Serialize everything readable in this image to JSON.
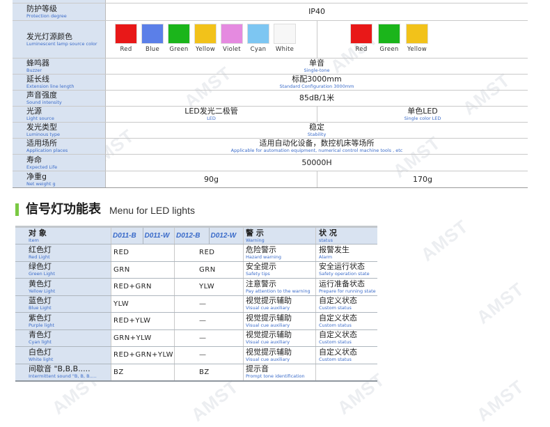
{
  "watermark": "AMST",
  "spec": {
    "top_partial": "",
    "protection": {
      "label_zh": "防护等级",
      "label_en": "Protection degree",
      "value": "IP40"
    },
    "lamp_color": {
      "label_zh": "发光灯源颜色",
      "label_en": "Luminescent lamp source color",
      "left": [
        {
          "name": "Red",
          "color": "#e81818"
        },
        {
          "name": "Blue",
          "color": "#5b7fe8"
        },
        {
          "name": "Green",
          "color": "#1bb51b"
        },
        {
          "name": "Yellow",
          "color": "#f2c21a"
        },
        {
          "name": "Violet",
          "color": "#e58ae0"
        },
        {
          "name": "Cyan",
          "color": "#7dc6f2"
        },
        {
          "name": "White",
          "color": "#f7f7f7"
        }
      ],
      "right": [
        {
          "name": "Red",
          "color": "#e81818"
        },
        {
          "name": "Green",
          "color": "#1bb51b"
        },
        {
          "name": "Yellow",
          "color": "#f2c21a"
        }
      ]
    },
    "buzzer": {
      "label_zh": "蜂鸣器",
      "label_en": "Buzzer",
      "value_zh": "单音",
      "value_en": "Single-tone"
    },
    "extension": {
      "label_zh": "延长线",
      "label_en": "Extension line length",
      "value_zh": "标配3000mm",
      "value_en": "Standard Configuration 3000mm"
    },
    "sound": {
      "label_zh": "声音强度",
      "label_en": "Sound intensity",
      "value": "85dB/1米"
    },
    "light_source": {
      "label_zh": "光源",
      "label_en": "Light source",
      "left_zh": "LED发光二极管",
      "left_en": "LED",
      "right_zh": "单色LED",
      "right_en": "Single color LED"
    },
    "luminous_type": {
      "label_zh": "发光类型",
      "label_en": "Luminous type",
      "value_zh": "稳定",
      "value_en": "Stability"
    },
    "application": {
      "label_zh": "适用场所",
      "label_en": "Application places",
      "value_zh": "适用自动化设备，数控机床等场所",
      "value_en": "Applicable for automation equipment, numerical control machine tools , etc"
    },
    "life": {
      "label_zh": "寿命",
      "label_en": "Expected Life",
      "value": "50000H"
    },
    "weight": {
      "label_zh": "净重g",
      "label_en": "Net weight g",
      "left": "90g",
      "right": "170g"
    }
  },
  "section": {
    "title_zh": "信号灯功能表",
    "title_en": "Menu for LED lights",
    "accent": "#7ac943"
  },
  "func_table": {
    "header": {
      "item_zh": "对  象",
      "item_en": "Item",
      "models_a": [
        "D011-B",
        "D011-W"
      ],
      "models_b": [
        "D012-B",
        "D012-W"
      ],
      "warning_zh": "警  示",
      "warning_en": "Warning",
      "status_zh": "状  况",
      "status_en": "status"
    },
    "rows": [
      {
        "item_zh": "红色灯",
        "item_en": "Red Light",
        "d011": "RED",
        "d012": "RED",
        "warn_zh": "危险警示",
        "warn_en": "Hazard warning",
        "status_zh": "报警发生",
        "status_en": "Alarm"
      },
      {
        "item_zh": "绿色灯",
        "item_en": "Green Light",
        "d011": "GRN",
        "d012": "GRN",
        "warn_zh": "安全提示",
        "warn_en": "Safety  tips",
        "status_zh": "安全运行状态",
        "status_en": "Safety operation state"
      },
      {
        "item_zh": "黄色灯",
        "item_en": "Yellow Light",
        "d011": "RED+GRN",
        "d012": "YLW",
        "warn_zh": "注意警示",
        "warn_en": "Pay attention to the warning",
        "status_zh": "运行准备状态",
        "status_en": "Prepare for running state"
      },
      {
        "item_zh": "蓝色灯",
        "item_en": "Blue Light",
        "d011": "YLW",
        "d012": "—",
        "warn_zh": "视觉提示辅助",
        "warn_en": "Visual cue auxiliary",
        "status_zh": "自定义状态",
        "status_en": "Custom status"
      },
      {
        "item_zh": "紫色灯",
        "item_en": "Purple light",
        "d011": "RED+YLW",
        "d012": "—",
        "warn_zh": "视觉提示辅助",
        "warn_en": "Visual cue auxiliary",
        "status_zh": "自定义状态",
        "status_en": "Custom status"
      },
      {
        "item_zh": "青色灯",
        "item_en": "Cyan light",
        "d011": "GRN+YLW",
        "d012": "—",
        "warn_zh": "视觉提示辅助",
        "warn_en": "Visual cue auxiliary",
        "status_zh": "自定义状态",
        "status_en": "Custom status"
      },
      {
        "item_zh": "白色灯",
        "item_en": "White light",
        "d011": "RED+GRN+YLW",
        "d012": "—",
        "warn_zh": "视觉提示辅助",
        "warn_en": "Visual cue auxiliary",
        "status_zh": "自定义状态",
        "status_en": "Custom status"
      },
      {
        "item_zh": "间歇音 \"B,B,B.....",
        "item_en": "Intermittent sound \"B, B, B.....",
        "d011": "BZ",
        "d012": "BZ",
        "warn_zh": "提示音",
        "warn_en": "Prompt tone identification",
        "status_zh": "",
        "status_en": ""
      }
    ]
  }
}
